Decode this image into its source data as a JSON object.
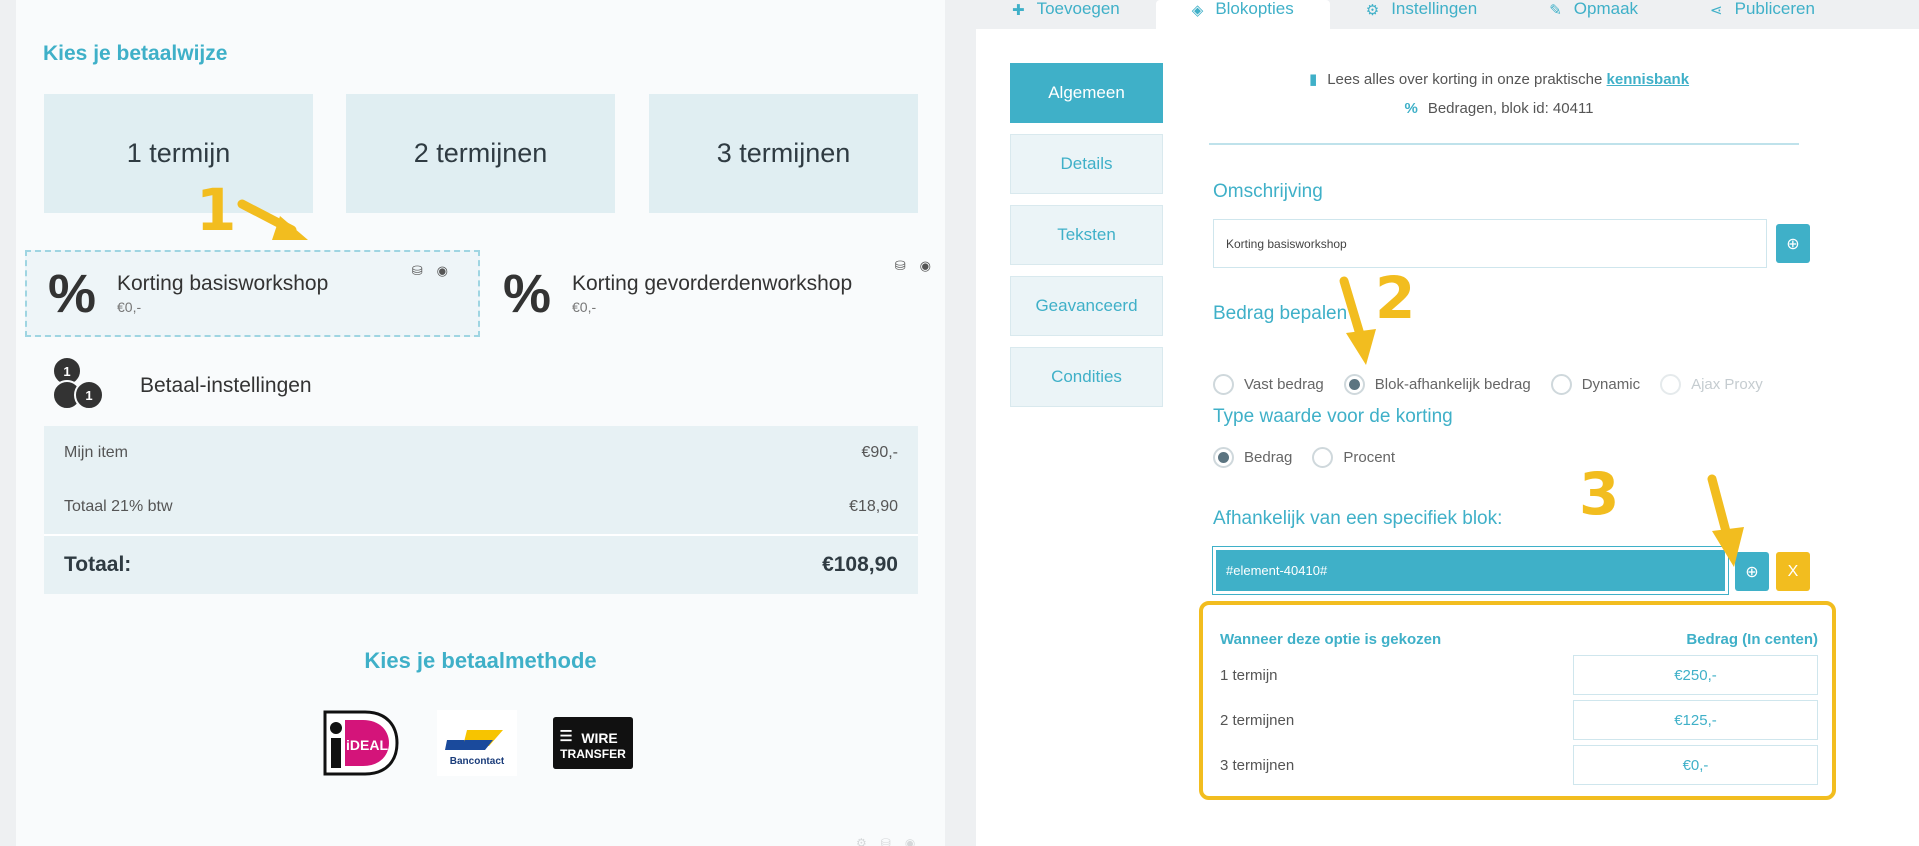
{
  "left": {
    "pay_title": "Kies je betaalwijze",
    "terms": [
      "1 termijn",
      "2 termijnen",
      "3 termijnen"
    ],
    "discounts": [
      {
        "title": "Korting basisworkshop",
        "amount": "€0,-",
        "selected": true
      },
      {
        "title": "Korting gevorderdenworkshop",
        "amount": "€0,-",
        "selected": false
      }
    ],
    "discount_icon": "percent-icon",
    "settings_label": "Betaal-instellingen",
    "summary": [
      {
        "label": "Mijn item",
        "value": "€90,-"
      },
      {
        "label": "Totaal 21% btw",
        "value": "€18,90"
      }
    ],
    "total_label": "Totaal:",
    "total_value": "€108,90",
    "method_title": "Kies je betaalmethode",
    "methods": [
      {
        "name": "iDEAL",
        "logo_text": "iDEAL"
      },
      {
        "name": "Bancontact",
        "logo_text": "Bancontact"
      },
      {
        "name": "Wire Transfer",
        "logo_text_1": "WIRE",
        "logo_text_2": "TRANSFER"
      }
    ]
  },
  "tabs": [
    {
      "label": "Toevoegen",
      "icon": "plus-icon",
      "active": false
    },
    {
      "label": "Blokopties",
      "icon": "cube-icon",
      "active": true
    },
    {
      "label": "Instellingen",
      "icon": "gear-icon",
      "active": false
    },
    {
      "label": "Opmaak",
      "icon": "brush-icon",
      "active": false
    },
    {
      "label": "Publiceren",
      "icon": "share-icon",
      "active": false
    }
  ],
  "side_nav": [
    {
      "label": "Algemeen",
      "active": true
    },
    {
      "label": "Details",
      "active": false
    },
    {
      "label": "Teksten",
      "active": false
    },
    {
      "label": "Geavanceerd",
      "active": false
    },
    {
      "label": "Condities",
      "active": false
    }
  ],
  "info": {
    "kb_text": "Lees alles over korting in onze praktische",
    "kb_link": "kennisbank",
    "block_text": "Bedragen, blok id: 40411"
  },
  "form": {
    "omschrijving_label": "Omschrijving",
    "omschrijving_value": "Korting basisworkshop",
    "bedrag_label": "Bedrag bepalen",
    "bedrag_options": [
      {
        "label": "Vast bedrag",
        "checked": false,
        "disabled": false
      },
      {
        "label": "Blok-afhankelijk bedrag",
        "checked": true,
        "disabled": false
      },
      {
        "label": "Dynamic",
        "checked": false,
        "disabled": false
      },
      {
        "label": "Ajax Proxy",
        "checked": false,
        "disabled": true
      }
    ],
    "type_label": "Type waarde voor de korting",
    "type_options": [
      {
        "label": "Bedrag",
        "checked": true
      },
      {
        "label": "Procent",
        "checked": false
      }
    ],
    "afh_label": "Afhankelijk van een specifiek blok:",
    "element_value": "#element-40410#",
    "clear_label": "X"
  },
  "mapping": {
    "head_option": "Wanneer deze optie is gekozen",
    "head_amount": "Bedrag (In centen)",
    "rows": [
      {
        "option": "1 termijn",
        "amount": "€250,-"
      },
      {
        "option": "2 termijnen",
        "amount": "€125,-"
      },
      {
        "option": "3 termijnen",
        "amount": "€0,-"
      }
    ]
  },
  "annotations": [
    "1",
    "2",
    "3"
  ],
  "colors": {
    "accent": "#3fb0c8",
    "annotation": "#f2bd1f"
  }
}
